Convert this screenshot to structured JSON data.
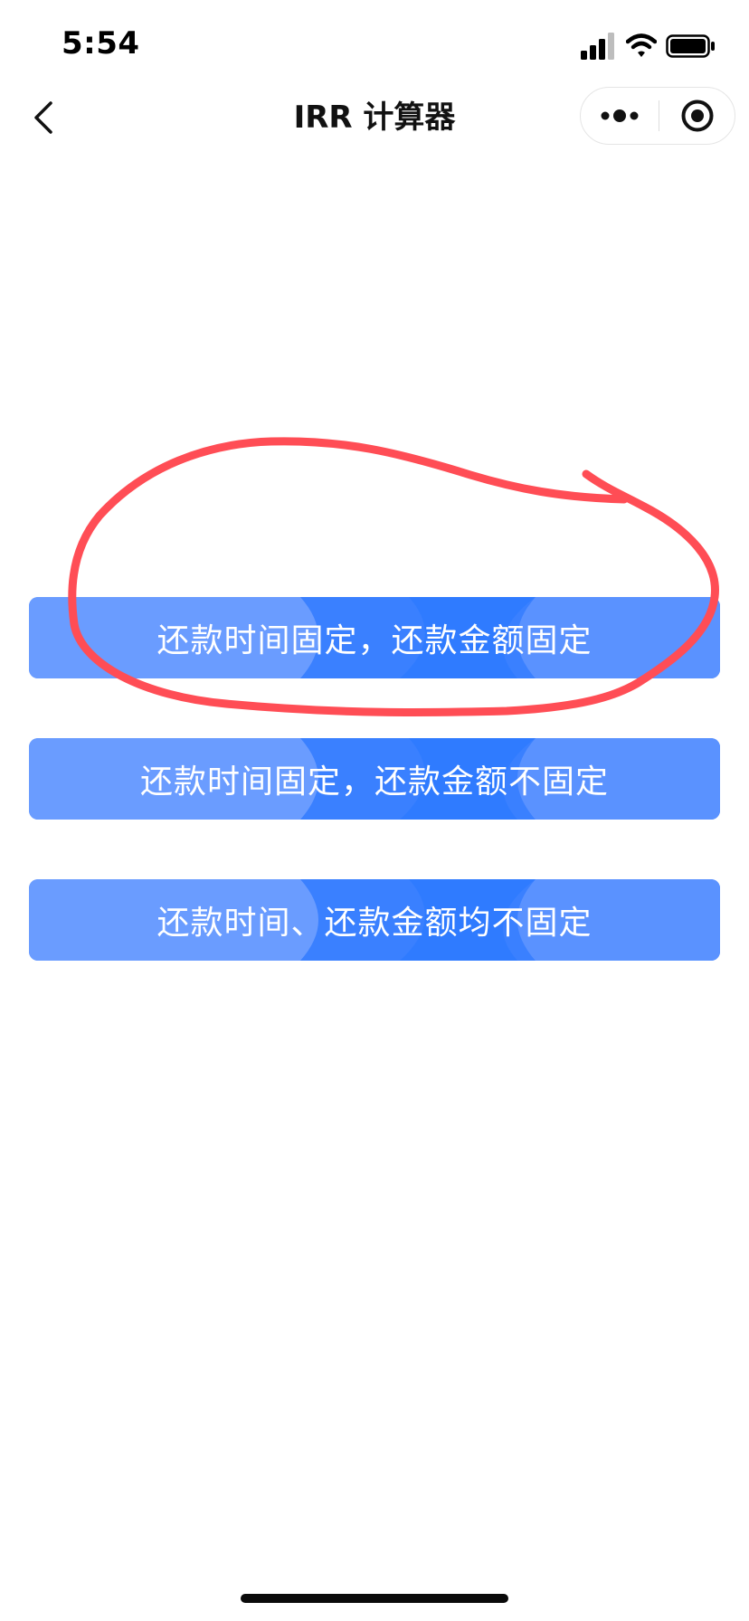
{
  "status_bar": {
    "time": "5:54",
    "icons": [
      "cellular-signal-icon",
      "wifi-icon",
      "battery-icon"
    ]
  },
  "nav": {
    "title": "IRR 计算器",
    "back_icon": "chevron-left-icon",
    "more_icon": "more-dots-icon",
    "close_icon": "target-circle-icon"
  },
  "options": [
    {
      "label": "还款时间固定，还款金额固定"
    },
    {
      "label": "还款时间固定，还款金额不固定"
    },
    {
      "label": "还款时间、还款金额均不固定"
    }
  ],
  "colors": {
    "button_base": "#5b93ff",
    "button_accent": "#2f7bff",
    "annotation": "#ff4d55"
  }
}
